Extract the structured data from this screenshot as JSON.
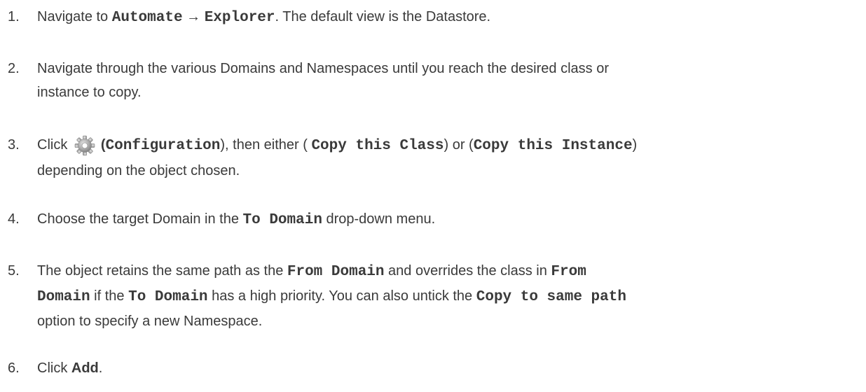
{
  "steps": [
    {
      "number": "1.",
      "parts": {
        "a": "Navigate to ",
        "b": "Automate",
        "c": " → ",
        "d": "Explorer",
        "e": ". The default view is the Datastore."
      }
    },
    {
      "number": "2.",
      "line1": "Navigate through the various Domains and Namespaces until you reach the desired class or",
      "line2": "instance to copy."
    },
    {
      "number": "3.",
      "parts": {
        "a": "Click ",
        "b": "(",
        "c": "Configuration",
        "d": "), then either ( ",
        "e": "Copy this Class",
        "f": ") or (",
        "g": "Copy this Instance",
        "h": ")"
      },
      "line2": "depending on the object chosen.",
      "icon": "gear-icon"
    },
    {
      "number": "4.",
      "parts": {
        "a": "Choose the target Domain in the ",
        "b": "To Domain",
        "c": " drop-down menu."
      }
    },
    {
      "number": "5.",
      "parts": {
        "a": "The object retains the same path as the ",
        "b": "From Domain",
        "c": " and overrides the class in ",
        "d": "From",
        "e": "Domain",
        "f": " if the ",
        "g": "To Domain",
        "h": " has a high priority. You can also untick the ",
        "i": "Copy to same path",
        "j": "option to specify a new Namespace."
      }
    },
    {
      "number": "6.",
      "parts": {
        "a": "Click ",
        "b": "Add",
        "c": "."
      }
    }
  ]
}
